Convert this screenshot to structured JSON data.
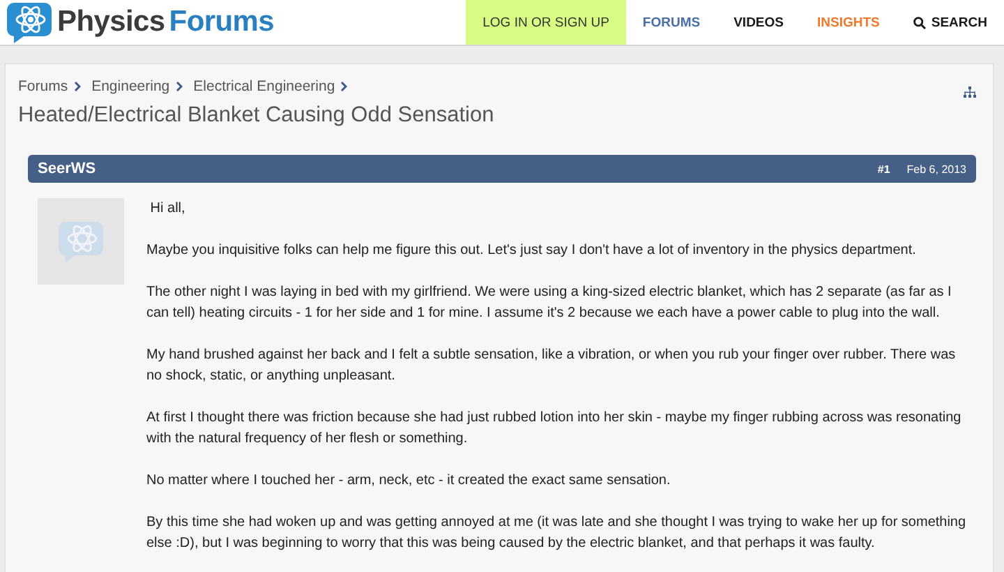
{
  "logo": {
    "word_1": "Physics",
    "word_2": "Forums"
  },
  "nav": [
    {
      "label": "LOG IN OR SIGN UP",
      "kind": "link",
      "highlighted": true
    },
    {
      "label": "FORUMS",
      "kind": "link",
      "color": "#4a6ea8",
      "highlighted": false
    },
    {
      "label": "VIDEOS",
      "kind": "link",
      "color": "#1a1a1a",
      "highlighted": false
    },
    {
      "label": "INSIGHTS",
      "kind": "link",
      "color": "#f07a2a",
      "highlighted": false
    },
    {
      "label": "SEARCH",
      "kind": "search",
      "color": "#1a1a1a",
      "highlighted": false
    }
  ],
  "breadcrumbs": [
    "Forums",
    "Engineering",
    "Electrical Engineering"
  ],
  "thread_title": "Heated/Electrical Blanket Causing Odd Sensation",
  "post": {
    "author": "SeerWS",
    "number": "#1",
    "date": "Feb 6, 2013",
    "paragraphs": [
      " Hi all,",
      "Maybe you inquisitive folks can help me figure this out. Let's just say I don't have a lot of inventory in the physics department.",
      "The other night I was laying in bed with my girlfriend. We were using a king-sized electric blanket, which has 2 separate (as far as I can tell) heating circuits - 1 for her side and 1 for mine. I assume it's 2 because we each have a power cable to plug into the wall.",
      "My hand brushed against her back and I felt a subtle sensation, like a vibration, or when you rub your finger over rubber. There was no shock, static, or anything unpleasant.",
      "At first I thought there was friction because she had just rubbed lotion into her skin - maybe my finger rubbing across was resonating with the natural frequency of her flesh or something.",
      "No matter where I touched her - arm, neck, etc - it created the exact same sensation.",
      "By this time she had woken up and was getting annoyed at me (it was late and she thought I was trying to wake her up for something else :D), but I was beginning to worry that this was being caused by the electric blanket, and that perhaps it was faulty."
    ]
  }
}
